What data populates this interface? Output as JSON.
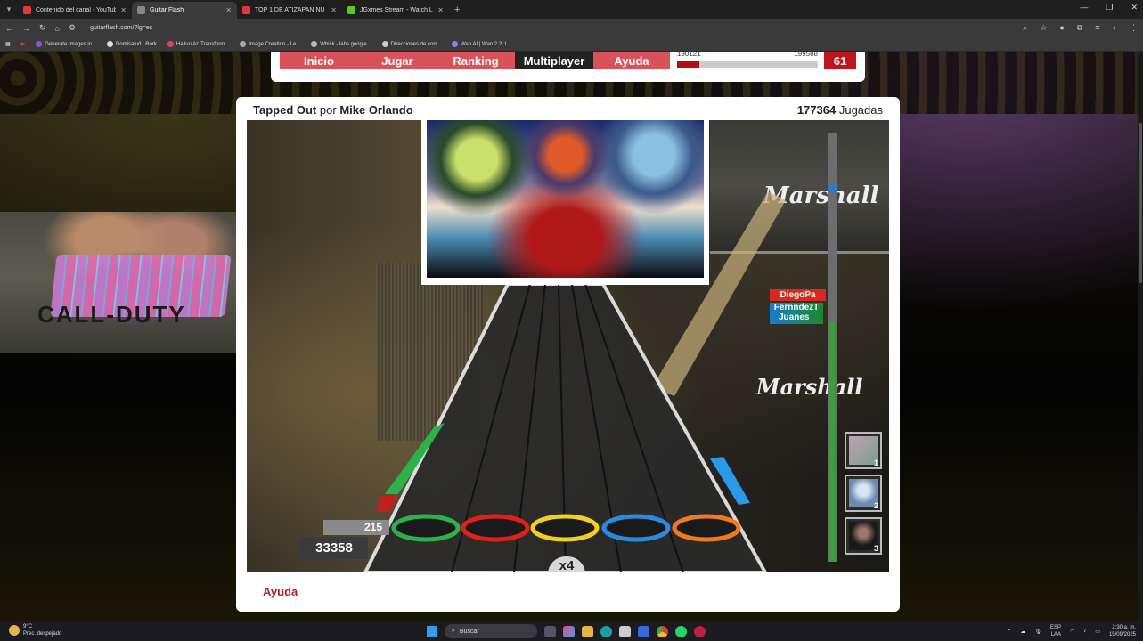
{
  "browser": {
    "tabs": [
      {
        "title": "Contenido del canal - YouTube",
        "active": false,
        "color": "#e53935"
      },
      {
        "title": "Guitar Flash",
        "active": true,
        "color": "#888888"
      },
      {
        "title": "TOP 1 DE ATIZAPAN NU",
        "active": false,
        "color": "#e53935"
      },
      {
        "title": "JGxmes Stream - Watch Live o",
        "active": false,
        "color": "#52d017"
      }
    ],
    "url": "guitarflash.com/?lg=es",
    "bookmarks": [
      {
        "label": "Generate Images in...",
        "color": "#8a56d8"
      },
      {
        "label": "Domisalud | Rork",
        "color": "#dddddd"
      },
      {
        "label": "Hailuo AI: Transform...",
        "color": "#e04060"
      },
      {
        "label": "Image Creation - Le...",
        "color": "#aaaaaa"
      },
      {
        "label": "Whisk - labs.google...",
        "color": "#bbbbbb"
      },
      {
        "label": "Direcciones de corr...",
        "color": "#cccccc"
      },
      {
        "label": "Wan AI | Wan 2.2: L...",
        "color": "#9a7ae0"
      }
    ]
  },
  "nav": {
    "items": [
      "Inicio",
      "Jugar",
      "Ranking",
      "Multiplayer",
      "Ayuda"
    ],
    "active": "Multiplayer",
    "progress_left": "190121",
    "progress_right": "199588",
    "progress_fraction": 0.16,
    "level": "61"
  },
  "song": {
    "title": "Tapped Out",
    "by": "por",
    "artist": "Mike Orlando",
    "plays_count": "177364",
    "plays_label": "Jugadas"
  },
  "game": {
    "amp_brand": "Marshall",
    "players": [
      "DiegoPa",
      "FernndezT",
      "Juanes_"
    ],
    "ranks": [
      "1",
      "2",
      "3"
    ],
    "streak": "215",
    "score": "33358",
    "multiplier": "x4",
    "fret_colors": [
      "#2bb34a",
      "#e0201c",
      "#f0d020",
      "#2a8ae0",
      "#f07a20"
    ],
    "meter_fill_fraction": 0.56
  },
  "footer": {
    "help": "Ayuda"
  },
  "webcam": {
    "text": "CALL-DUTY"
  },
  "taskbar": {
    "temp": "9°C",
    "weather": "Prec. despejado",
    "search": "Buscar",
    "lang1": "ESP",
    "lang2": "LAA",
    "time": "2:30 a. m.",
    "date": "15/09/2025"
  }
}
